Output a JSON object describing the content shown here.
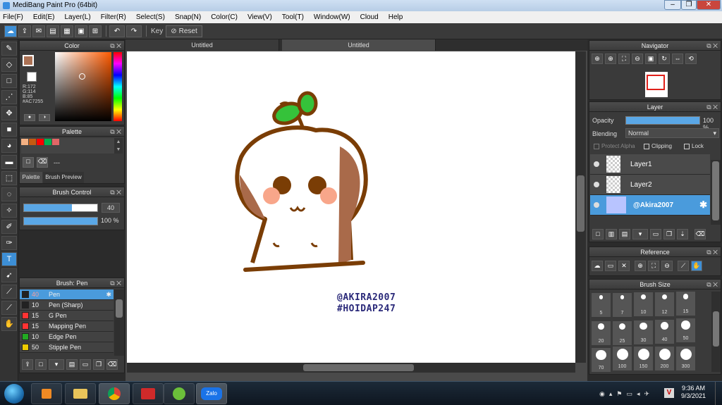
{
  "window": {
    "title": "MediBang Paint Pro (64bit)",
    "minimize": "–",
    "maximize": "❐",
    "close": "✕"
  },
  "menu": [
    "File(F)",
    "Edit(E)",
    "Layer(L)",
    "Filter(R)",
    "Select(S)",
    "Snap(N)",
    "Color(C)",
    "View(V)",
    "Tool(T)",
    "Window(W)",
    "Cloud",
    "Help"
  ],
  "toolbar": {
    "key_label": "Key",
    "reset_label": "Reset"
  },
  "tabs": [
    "Untitled",
    "Untitled"
  ],
  "color_panel": {
    "title": "Color",
    "r": "R:172",
    "g": "G:114",
    "b": "B:85",
    "hex": "#AC7255",
    "current_color": "#ac7255"
  },
  "palette_panel": {
    "title": "Palette",
    "swatches": [
      "#f4b183",
      "#c55a11",
      "#ff0000",
      "#00b050",
      "#e06666"
    ],
    "dashes": "---",
    "tab_palette": "Palette",
    "tab_brush_preview": "Brush Preview"
  },
  "brush_control": {
    "title": "Brush Control",
    "size": "40",
    "size_fraction": 0.65,
    "opacity": "100 %",
    "opacity_fraction": 1.0
  },
  "brush_list": {
    "title": "Brush: Pen",
    "items": [
      {
        "size": "40",
        "name": "Pen",
        "color": "#222222"
      },
      {
        "size": "10",
        "name": "Pen (Sharp)",
        "color": "#222222"
      },
      {
        "size": "15",
        "name": "G Pen",
        "color": "#ff3333"
      },
      {
        "size": "15",
        "name": "Mapping Pen",
        "color": "#ff3333"
      },
      {
        "size": "10",
        "name": "Edge Pen",
        "color": "#22aa22"
      },
      {
        "size": "50",
        "name": "Stipple Pen",
        "color": "#eecc00"
      }
    ]
  },
  "navigator": {
    "title": "Navigator"
  },
  "layer_panel": {
    "title": "Layer",
    "opacity_label": "Opacity",
    "opacity_value": "100 %",
    "opacity_fraction": 1.0,
    "blending_label": "Blending",
    "blending_value": "Normal",
    "protect_alpha": "Protect Alpha",
    "clipping": "Clipping",
    "lock": "Lock",
    "layers": [
      {
        "name": "Layer1"
      },
      {
        "name": "Layer2"
      },
      {
        "name": "@Akira2007"
      }
    ]
  },
  "reference_panel": {
    "title": "Reference"
  },
  "brush_size_panel": {
    "title": "Brush Size",
    "sizes": [
      "5",
      "7",
      "10",
      "12",
      "15",
      "20",
      "25",
      "30",
      "40",
      "50",
      "70",
      "100",
      "150",
      "200",
      "300"
    ]
  },
  "canvas_text": {
    "line1": "@AKIRA2007",
    "line2": "#HOIDAP247"
  },
  "taskbar": {
    "time": "9:36 AM",
    "date": "9/3/2021",
    "zalo": "Zalo"
  }
}
